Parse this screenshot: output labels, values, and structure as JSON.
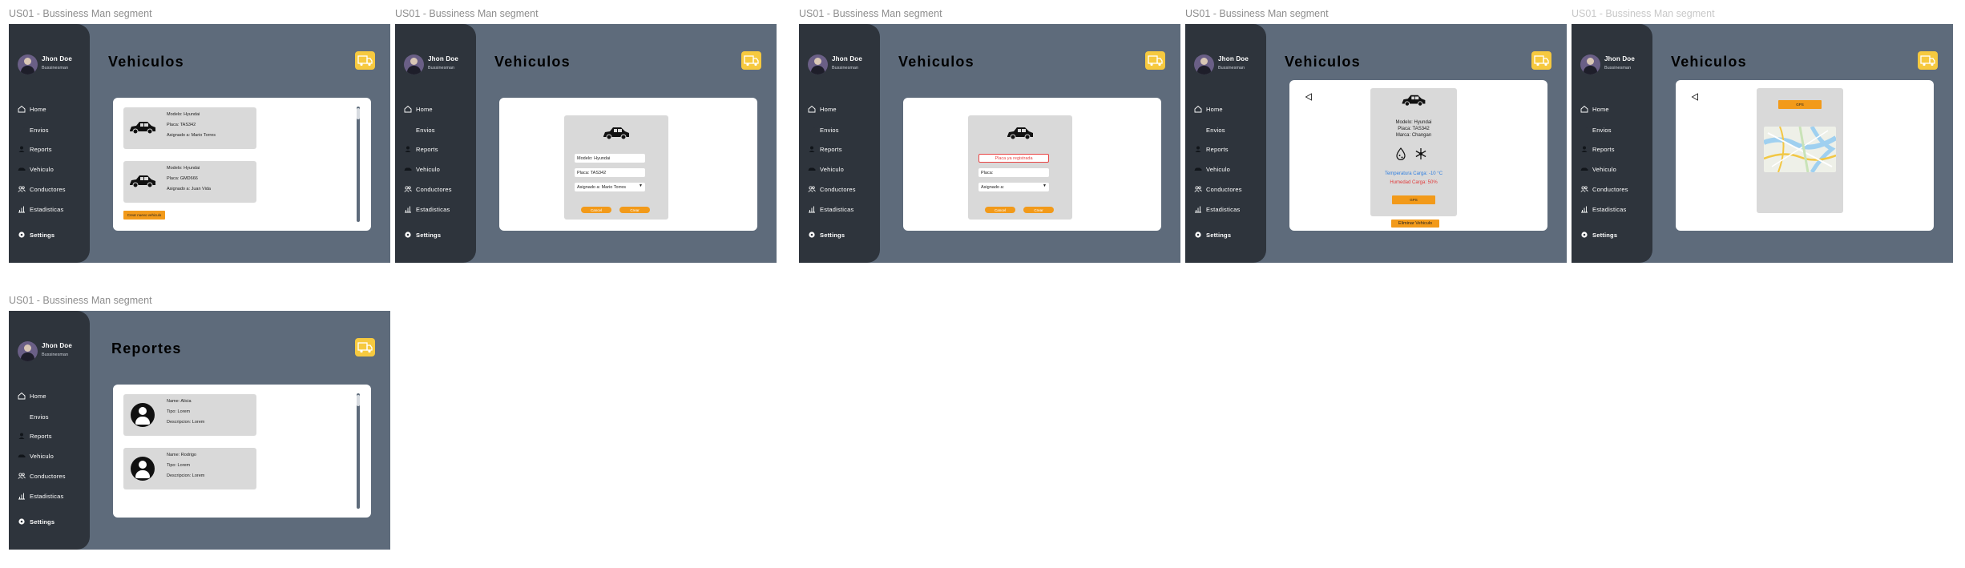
{
  "sidebar": {
    "user_name": "Jhon Doe",
    "user_role": "Bussinesman",
    "items": [
      {
        "label": "Home",
        "icon": "home-icon"
      },
      {
        "label": "Envios",
        "icon": "send-icon"
      },
      {
        "label": "Reports",
        "icon": "reports-icon"
      },
      {
        "label": "Vehiculo",
        "icon": "car-icon"
      },
      {
        "label": "Conductores",
        "icon": "users-icon"
      },
      {
        "label": "Estadisticas",
        "icon": "chart-icon"
      },
      {
        "label": "Settings",
        "icon": "gear-icon"
      }
    ]
  },
  "frames": [
    {
      "title": "US01 - Bussiness Man segment",
      "page_title": "Vehiculos",
      "cards": [
        {
          "lines": [
            "Modelo: Hyundai",
            "Placa: TAS342",
            "Asignado a: Mario Torres"
          ]
        },
        {
          "lines": [
            "Modelo: Hyundai",
            "Placa: GMD666",
            "Asignado a: Juan Vida"
          ]
        }
      ],
      "create_button": "Crear nuevo vehiculo"
    },
    {
      "title": "US01 - Bussiness Man segment",
      "page_title": "Vehiculos",
      "fields": [
        "Modelo: Hyundai",
        "Placa: TAS342",
        "Asignado a: Mario Torres"
      ],
      "cancel_label": "Cancel",
      "save_label": "Crear"
    },
    {
      "title": "US01 - Bussiness Man segment",
      "page_title": "Vehiculos",
      "error_text": "Placa ya registrada",
      "fields": [
        "Placa:",
        "Asignado a:"
      ],
      "cancel_label": "Cancel",
      "save_label": "Crear"
    },
    {
      "title": "US01 - Bussiness Man segment",
      "page_title": "Vehiculos",
      "details": [
        "Modelo: Hyundai",
        "Placa: TAS342",
        "Marca: Changan"
      ],
      "temperature": "Temperatura Carga: -10 °C",
      "humidity": "Humedad Carga: 50%",
      "gps_label": "GPS",
      "delete_button": "Eliminar Vehiculo",
      "colors": {
        "temperature": "#2f7fe0",
        "humidity": "#e03a3a"
      }
    },
    {
      "title": "US01 - Bussiness Man segment",
      "page_title": "Vehiculos",
      "gps_label": "GPS"
    },
    {
      "title": "US01 - Bussiness Man segment",
      "page_title": "Reportes",
      "cards": [
        {
          "lines": [
            "Name: Alicia",
            "Tipo: Lorem",
            "Descripcion: Lorem"
          ]
        },
        {
          "lines": [
            "Name: Rodrigo",
            "Tipo: Lorem",
            "Descripcion: Lorem"
          ]
        }
      ]
    }
  ],
  "colors": {
    "frame_bg": "#5e6b7b",
    "sidebar_bg": "#2e343c",
    "accent_orange": "#f29a1a",
    "truck_yellow": "#f6c93f",
    "card_gray": "#d9d9d9"
  }
}
